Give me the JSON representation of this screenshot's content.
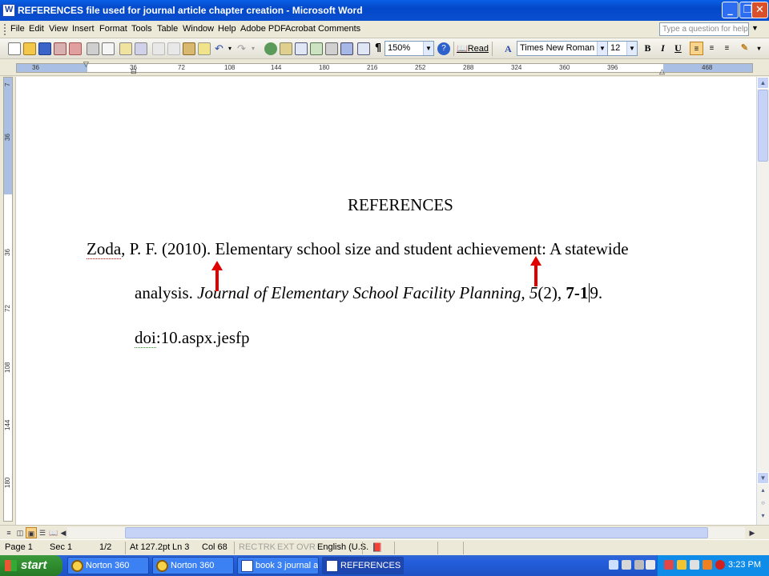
{
  "window": {
    "title": "REFERENCES file used for journal article chapter creation - Microsoft Word"
  },
  "menu": {
    "items": [
      "File",
      "Edit",
      "View",
      "Insert",
      "Format",
      "Tools",
      "Table",
      "Window",
      "Help",
      "Adobe PDF",
      "Acrobat Comments"
    ],
    "help_placeholder": "Type a question for help"
  },
  "toolbar": {
    "zoom": "150%",
    "read_label": "Read",
    "font_name": "Times New Roman",
    "font_size": "12",
    "bold_label": "B",
    "italic_label": "I",
    "underline_label": "U"
  },
  "ruler": {
    "ticks": [
      "36",
      "36",
      "72",
      "108",
      "144",
      "180",
      "216",
      "252",
      "288",
      "324",
      "360",
      "396",
      "468"
    ],
    "vticks": [
      "7",
      "36",
      "36",
      "72",
      "108",
      "144",
      "180"
    ]
  },
  "document": {
    "heading": "REFERENCES",
    "line1_author": "Zoda",
    "line1_rest": ", P. F. (2010). Elementary school size and student achievement: A statewide",
    "line2_plain": "analysis. ",
    "line2_italic": "Journal of Elementary School Facility Planning, 5",
    "line2_issue": "(2), ",
    "line2_pages": "7-1",
    "line2_pages_end": "9.",
    "line3_doi": "doi",
    "line3_rest": ":10.aspx.jesfp"
  },
  "status": {
    "page": "Page 1",
    "sec": "Sec 1",
    "pages": "1/2",
    "at": "At 127.2pt",
    "ln": "Ln 3",
    "col": "Col 68",
    "rec": "REC",
    "trk": "TRK",
    "ext": "EXT",
    "ovr": "OVR",
    "language": "English (U.S."
  },
  "taskbar": {
    "start_label": "start",
    "tasks": [
      "Norton 360",
      "Norton 360",
      "book 3 journal a...",
      "REFERENCES fil..."
    ],
    "clock": "3:23 PM"
  },
  "colors": {
    "titlebar": "#0a4fd0",
    "arrow": "#e00000",
    "taskbar": "#245edc",
    "start": "#2f8c2f"
  }
}
